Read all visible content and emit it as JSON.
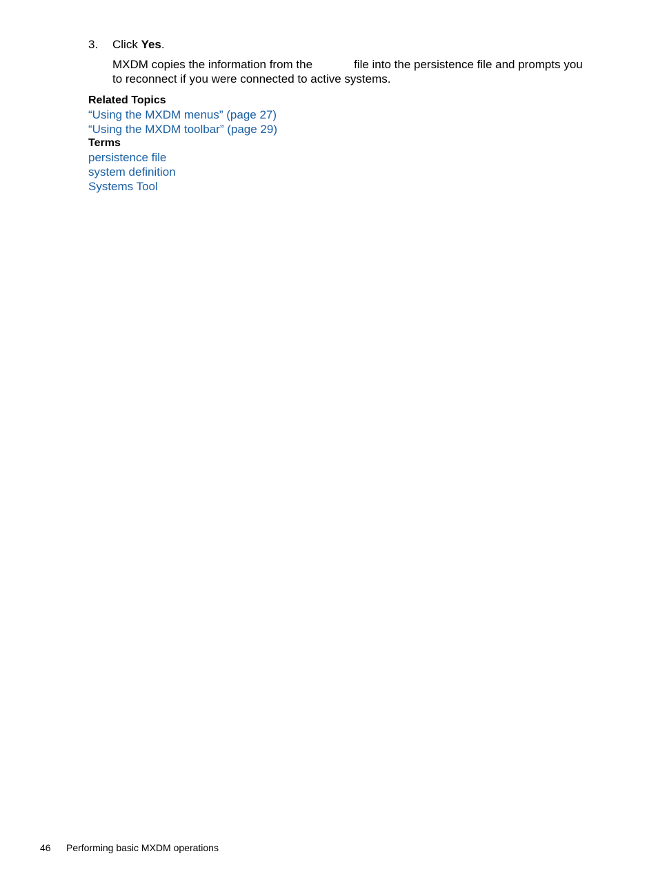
{
  "step": {
    "number": "3.",
    "prefix": "Click ",
    "bold": "Yes",
    "suffix": ".",
    "description_part1": "MXDM copies the information from the",
    "description_part2": "file into the persistence file and prompts you to reconnect if you were connected to active systems."
  },
  "related_topics": {
    "heading": "Related Topics",
    "links": [
      "“Using the MXDM menus” (page 27)",
      "“Using the MXDM toolbar” (page 29)"
    ]
  },
  "terms": {
    "heading": "Terms",
    "links": [
      "persistence file",
      "system definition",
      "Systems Tool"
    ]
  },
  "footer": {
    "page_number": "46",
    "section_title": "Performing basic MXDM operations"
  },
  "colors": {
    "link": "#1a5fa3"
  }
}
